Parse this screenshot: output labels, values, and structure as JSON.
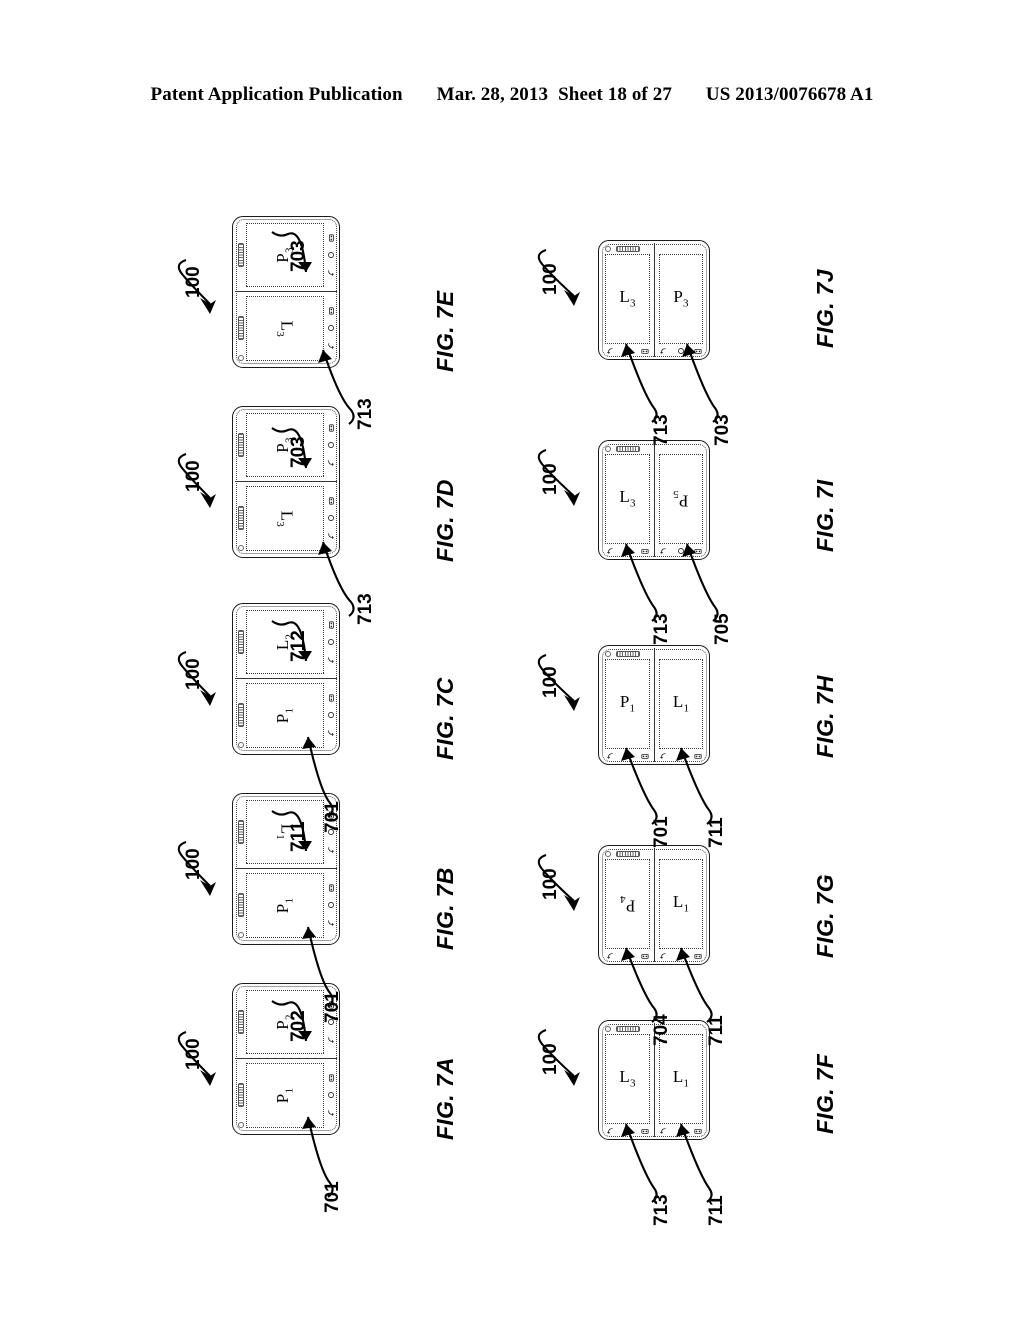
{
  "header": {
    "publication": "Patent Application Publication",
    "date": "Mar. 28, 2013",
    "sheet": "Sheet 18 of 27",
    "docnumber": "US 2013/0076678 A1"
  },
  "device_reference": "100",
  "figures": [
    {
      "id": "fig-7a",
      "label": "FIG. 7A",
      "orientation": "landscape-device",
      "device_ref": "100",
      "screens": [
        {
          "name": "left-screen",
          "text": "P",
          "sub": "1",
          "flipped": false,
          "ref": "701"
        },
        {
          "name": "right-screen",
          "text": "P",
          "sub": "2",
          "flipped": false,
          "ref": "702"
        }
      ]
    },
    {
      "id": "fig-7b",
      "label": "FIG. 7B",
      "orientation": "landscape-device",
      "device_ref": "100",
      "screens": [
        {
          "name": "left-screen",
          "text": "P",
          "sub": "1",
          "flipped": false,
          "ref": "701"
        },
        {
          "name": "right-screen",
          "text": "L",
          "sub": "1",
          "flipped": true,
          "ref": "711"
        }
      ]
    },
    {
      "id": "fig-7c",
      "label": "FIG. 7C",
      "orientation": "landscape-device",
      "device_ref": "100",
      "screens": [
        {
          "name": "left-screen",
          "text": "P",
          "sub": "1",
          "flipped": false,
          "ref": "701"
        },
        {
          "name": "right-screen",
          "text": "L",
          "sub": "2",
          "flipped": false,
          "ref": "712"
        }
      ]
    },
    {
      "id": "fig-7d",
      "label": "FIG. 7D",
      "orientation": "landscape-device",
      "device_ref": "100",
      "screens": [
        {
          "name": "left-screen",
          "text": "L",
          "sub": "3",
          "flipped": true,
          "ref": "713"
        },
        {
          "name": "right-screen",
          "text": "P",
          "sub": "3",
          "flipped": false,
          "ref": "703"
        }
      ]
    },
    {
      "id": "fig-7e",
      "label": "FIG. 7E",
      "orientation": "landscape-device",
      "device_ref": "100",
      "screens": [
        {
          "name": "left-screen",
          "text": "L",
          "sub": "3",
          "flipped": true,
          "ref": "713"
        },
        {
          "name": "right-screen",
          "text": "P",
          "sub": "3",
          "flipped": false,
          "ref": "703"
        }
      ]
    },
    {
      "id": "fig-7f",
      "label": "FIG. 7F",
      "orientation": "portrait-device",
      "device_ref": "100",
      "screens": [
        {
          "name": "left-screen",
          "text": "L",
          "sub": "3",
          "flipped": false,
          "ref": "713"
        },
        {
          "name": "right-screen",
          "text": "L",
          "sub": "1",
          "flipped": false,
          "ref": "711"
        }
      ]
    },
    {
      "id": "fig-7g",
      "label": "FIG. 7G",
      "orientation": "portrait-device",
      "device_ref": "100",
      "screens": [
        {
          "name": "left-screen",
          "text": "P",
          "sub": "4",
          "flipped": true,
          "ref": "704"
        },
        {
          "name": "right-screen",
          "text": "L",
          "sub": "1",
          "flipped": false,
          "ref": "711"
        }
      ]
    },
    {
      "id": "fig-7h",
      "label": "FIG. 7H",
      "orientation": "portrait-device",
      "device_ref": "100",
      "screens": [
        {
          "name": "left-screen",
          "text": "P",
          "sub": "1",
          "flipped": false,
          "ref": "701"
        },
        {
          "name": "right-screen",
          "text": "L",
          "sub": "1",
          "flipped": false,
          "ref": "711"
        }
      ]
    },
    {
      "id": "fig-7i",
      "label": "FIG. 7I",
      "orientation": "portrait-device",
      "device_ref": "100",
      "screens": [
        {
          "name": "left-screen",
          "text": "L",
          "sub": "3",
          "flipped": false,
          "ref": "713"
        },
        {
          "name": "right-screen",
          "text": "P",
          "sub": "5",
          "flipped": true,
          "ref": "705"
        }
      ]
    },
    {
      "id": "fig-7j",
      "label": "FIG. 7J",
      "orientation": "portrait-device",
      "device_ref": "100",
      "screens": [
        {
          "name": "left-screen",
          "text": "L",
          "sub": "3",
          "flipped": false,
          "ref": "713"
        },
        {
          "name": "right-screen",
          "text": "P",
          "sub": "3",
          "flipped": false,
          "ref": "703"
        }
      ]
    }
  ],
  "icons": {
    "back": "back-arrow-icon",
    "home": "home-circle-icon",
    "menu": "menu-grid-icon",
    "speaker": "speaker-grille-icon",
    "camera": "front-camera-icon"
  }
}
